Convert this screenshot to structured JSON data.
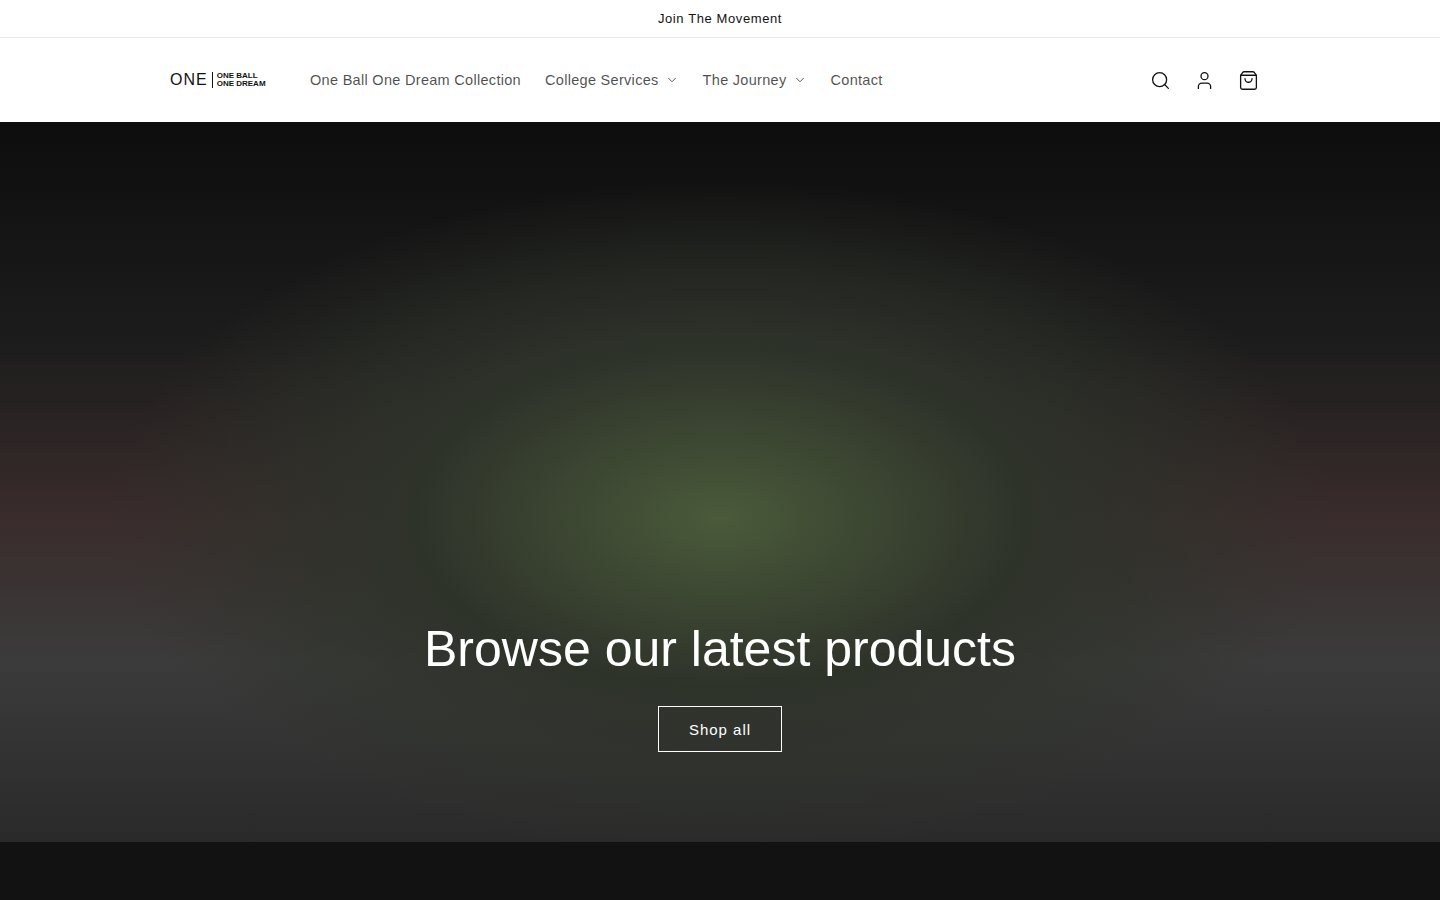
{
  "announcement": {
    "text": "Join The Movement"
  },
  "logo": {
    "mark": "ONE",
    "lines": [
      "ONE BALL",
      "ONE DREAM"
    ]
  },
  "nav": [
    {
      "label": "One Ball One Dream Collection",
      "kind": "link",
      "expanded": false
    },
    {
      "label": "College Services",
      "kind": "dropdown",
      "expanded": false
    },
    {
      "label": "The Journey",
      "kind": "dropdown",
      "expanded": false
    },
    {
      "label": "Contact",
      "kind": "link",
      "expanded": false
    }
  ],
  "hero": {
    "heading": "Browse our latest products",
    "button": "Shop all"
  }
}
